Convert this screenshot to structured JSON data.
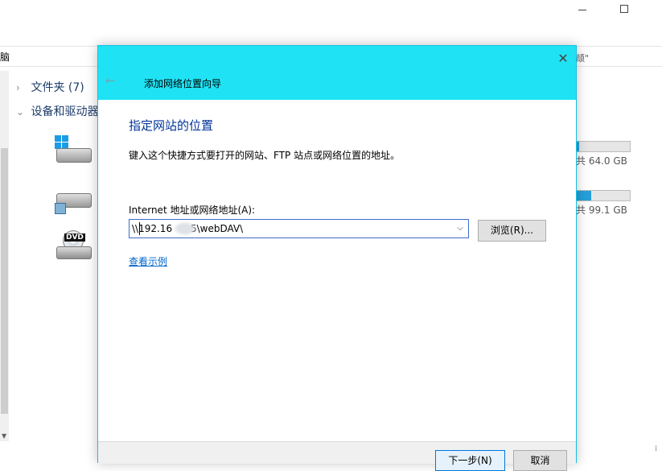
{
  "explorer": {
    "address_text": "脑",
    "address_right": "颃\"",
    "nav": {
      "folders": "文件夹 (7)",
      "devices": "设备和驱动器"
    },
    "drives": [
      {
        "capacity_text": "共 64.0 GB",
        "used_fraction": 0.04
      },
      {
        "capacity_text": "共 99.1 GB",
        "used_fraction": 0.27
      }
    ],
    "dvd_label": "DVD",
    "status_glyph": "⁞"
  },
  "dialog": {
    "title": "添加网络位置向导",
    "heading": "指定网站的位置",
    "description": "键入这个快捷方式要打开的网站、FTP 站点或网络位置的地址。",
    "field_label": "Internet 地址或网络地址(A):",
    "url_value": "\\\\192.16      5\\webDAV\\",
    "browse_label": "浏览(R)...",
    "example_link": "查看示例",
    "next_label": "下一步(N)",
    "cancel_label": "取消",
    "back_glyph": "←",
    "close_glyph": "✕",
    "dropdown_glyph": "⌵"
  },
  "colors": {
    "title_bar": "#1fe3f5",
    "heading": "#003399",
    "link": "#0066cc",
    "progress": "#26a0da"
  }
}
